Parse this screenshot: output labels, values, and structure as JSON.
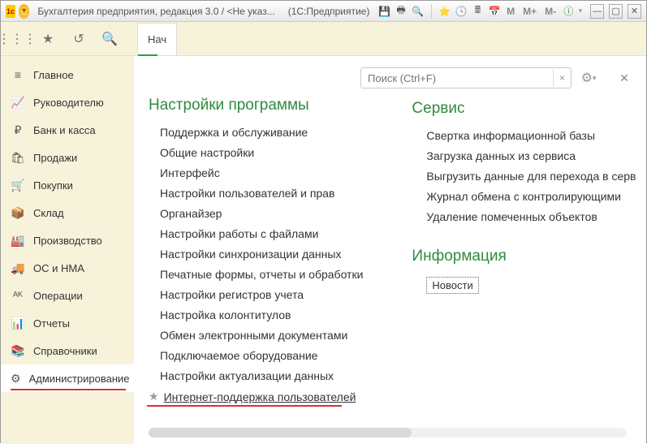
{
  "titlebar": {
    "title": "Бухгалтерия предприятия, редакция 3.0 / <Не указ...",
    "subtitle": "(1С:Предприятие)"
  },
  "toolbar": {
    "tab_label": "Нач"
  },
  "search": {
    "placeholder": "Поиск (Ctrl+F)"
  },
  "sidebar": {
    "items": [
      {
        "icon": "≡",
        "label": "Главное"
      },
      {
        "icon": "📈",
        "label": "Руководителю"
      },
      {
        "icon": "₽",
        "label": "Банк и касса"
      },
      {
        "icon": "🛍",
        "label": "Продажи"
      },
      {
        "icon": "🛒",
        "label": "Покупки"
      },
      {
        "icon": "📦",
        "label": "Склад"
      },
      {
        "icon": "🏭",
        "label": "Производство"
      },
      {
        "icon": "🚚",
        "label": "ОС и НМА"
      },
      {
        "icon": "ᴬᴷ",
        "label": "Операции"
      },
      {
        "icon": "📊",
        "label": "Отчеты"
      },
      {
        "icon": "📚",
        "label": "Справочники"
      },
      {
        "icon": "⚙",
        "label": "Администрирование"
      }
    ]
  },
  "content": {
    "settings_heading": "Настройки программы",
    "settings_links": [
      "Поддержка и обслуживание",
      "Общие настройки",
      "Интерфейс",
      "Настройки пользователей и прав",
      "Органайзер",
      "Настройки работы с файлами",
      "Настройки синхронизации данных",
      "Печатные формы, отчеты и обработки",
      "Настройки регистров учета",
      "Настройка колонтитулов",
      "Обмен электронными документами",
      "Подключаемое оборудование",
      "Настройки актуализации данных"
    ],
    "star_link": "Интернет-поддержка пользователей",
    "service_heading": "Сервис",
    "service_links": [
      "Свертка информационной базы",
      "Загрузка данных из сервиса",
      "Выгрузить данные для перехода в серв",
      "Журнал обмена с контролирующими",
      "Удаление помеченных объектов"
    ],
    "info_heading": "Информация",
    "info_link": "Новости"
  }
}
